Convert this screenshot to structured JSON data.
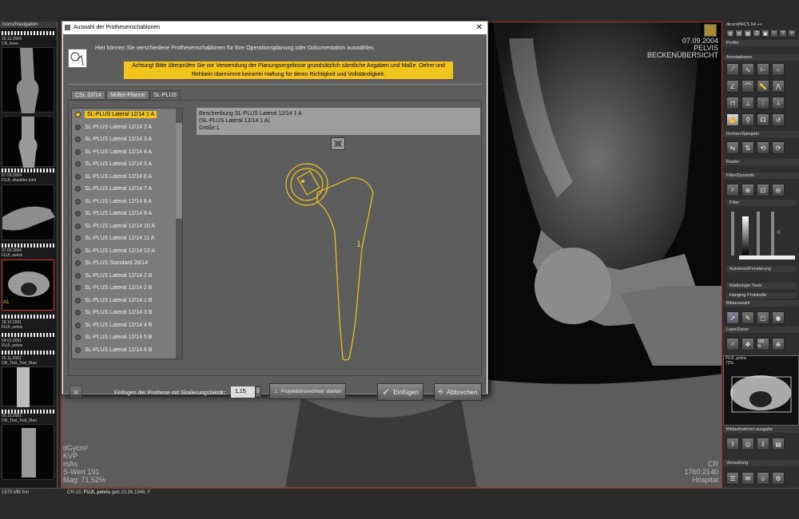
{
  "left_panel": {
    "header": "Icons/Navigation",
    "thumbs": [
      {
        "date": "10.12.2004",
        "desc": "CR, knee"
      },
      {
        "date": "07.09.2004",
        "desc": "FUJI, shoulder joint"
      },
      {
        "date": "07.09.2004",
        "desc": "FUJI, pelvis",
        "badge": "A1"
      },
      {
        "date": "18.10.2001",
        "desc": "FUJI, pelvis"
      },
      {
        "date": "09.01.2001",
        "desc": "FUJI, pelvis"
      },
      {
        "date": "15.11.2001",
        "desc": "OR_Test_Test_Man"
      },
      {
        "date": "25.10.2001",
        "desc": "OR_Test_Test_Man"
      }
    ],
    "free_space": "1679 MB frei"
  },
  "overlay": {
    "date": "07.09.2004",
    "region": "PELVIS",
    "view": "BECKENÜBERSICHT",
    "bl": [
      "dGycm²",
      "KVP",
      "mAs",
      "S-Wert 191",
      "Mag: 71,52%"
    ],
    "br": [
      "CR",
      "1760:2140",
      "Hospital"
    ]
  },
  "status": {
    "text": "CR-15; ",
    "patient": "FUJI, pelvis",
    "rest": " geb.10.06.1946; F"
  },
  "right_panel": {
    "app": "dicomPACS 64 ++",
    "sections": [
      "Profile",
      "Annotationen",
      "Drehen/Spiegeln",
      "Raster",
      "Filter/Dynamik",
      "Filter",
      "Autolevel/Fensterung",
      "Radiologie-Tools",
      "Hanging Protokolle",
      "Bildauswahl",
      "Lupe/Zoom",
      "Bildaufnahme/-ausgabe",
      "Verwaltung"
    ],
    "preview_title": "FUJI, pelvis",
    "preview_zoom": "72%",
    "slider_value": "0",
    "zoom_label": "100 %"
  },
  "dialog": {
    "title": "Auswahl der Prothesenschablonen",
    "intro": "Hier können Sie verschiedene Prothesenschablonen für Ihre Operationsplanung oder Dokumentation auswählen.",
    "warning": "Achtung! Bitte überprüfen Sie vor Verwendung der Planungsergebisse grundsätzlich sämtliche Angaben und Maße. Oehm und Rehbein übernimmt keinerlei Haftung für deren Richtigkeit und Vollständigkeit.",
    "tabs": [
      "CSL 32/14",
      "Müller-Pfanne",
      "SL-PLUS"
    ],
    "active_tab": 2,
    "items": [
      "SL-PLUS Lateral 12/14 1 A",
      "SL-PLUS Lateral 12/14 2 A",
      "SL-PLUS Lateral 12/14 3 A",
      "SL-PLUS Lateral 12/14 4 A",
      "SL-PLUS Lateral 12/14 5 A",
      "SL-PLUS Lateral 12/14 6 A",
      "SL-PLUS Lateral 12/14 7 A",
      "SL-PLUS Lateral 12/14 8 A",
      "SL-PLUS Lateral 12/14 9 A",
      "SL-PLUS Lateral 12/14 10 A",
      "SL-PLUS Lateral 12/14 11 A",
      "SL-PLUS Lateral 12/14 12 A",
      "SL-PLUS Standard 28/14",
      "SL-PLUS Lateral 12/14 2 B",
      "SL-PLUS Lateral 12/14 2 B",
      "SL-PLUS Lateral 12/14 1 B",
      "SL-PLUS Lateral 12/14 3 B",
      "SL-PLUS Lateral 12/14 4 B",
      "SL-PLUS Lateral 12/14 5 B",
      "SL-PLUS Lateral 12/14 6 B"
    ],
    "selected_index": 0,
    "desc": [
      "Beschreibung SL-PLUS Lateral 12/14 1 A",
      "(SL-PLUS Lateral 12/14 1 A)",
      "Größe:1"
    ],
    "template_label": "1",
    "scale_label": "Einfügen der Prothese mit Skalierungsfaktor:",
    "scale_prefix": "1 :",
    "scale_value": "1,15",
    "calc_btn": "Projektionsrechner starten",
    "insert_btn": "Einfügen",
    "cancel_btn": "Abbrechen",
    "accent": "#f3c51c"
  }
}
